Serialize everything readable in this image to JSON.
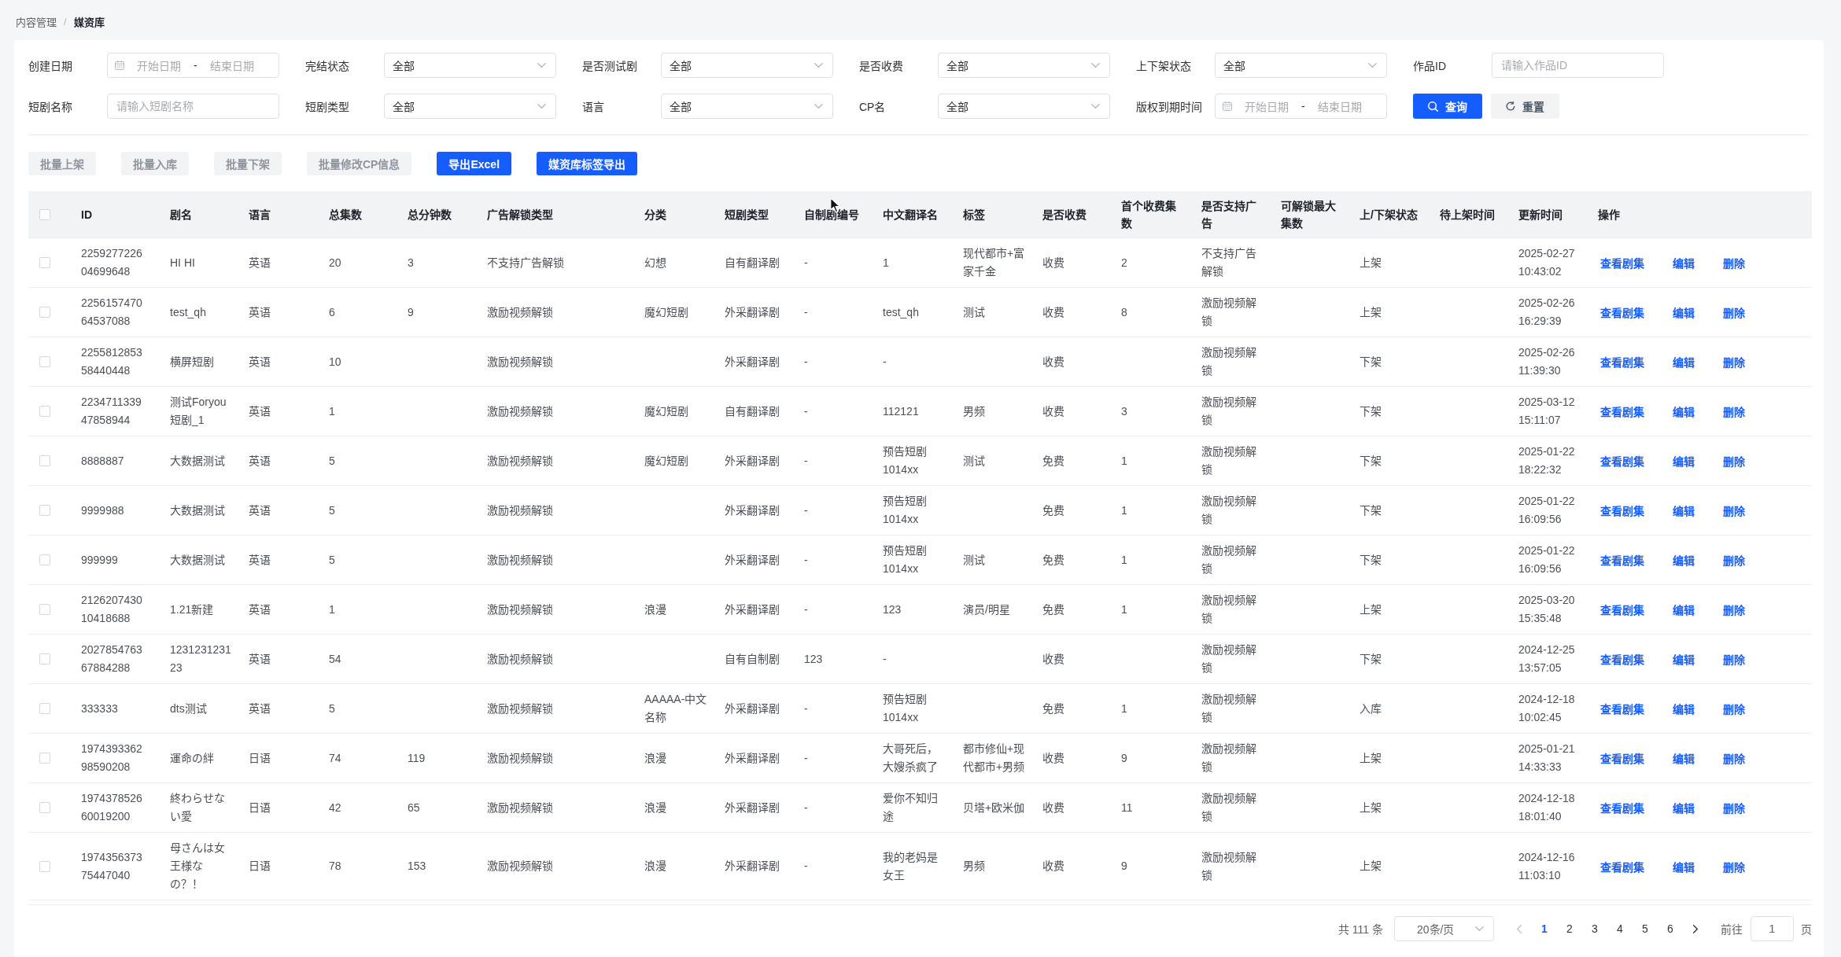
{
  "breadcrumb": {
    "separator": "/",
    "items": [
      {
        "label": "内容管理",
        "current": false
      },
      {
        "label": "媒资库",
        "current": true
      }
    ]
  },
  "filters": [
    {
      "kind": "date_range",
      "label": "创建日期",
      "start_placeholder": "开始日期",
      "separator": "-",
      "end_placeholder": "结束日期"
    },
    {
      "kind": "select",
      "label": "完结状态",
      "value": "全部"
    },
    {
      "kind": "select",
      "label": "是否测试剧",
      "value": "全部"
    },
    {
      "kind": "select",
      "label": "是否收费",
      "value": "全部"
    },
    {
      "kind": "select",
      "label": "上下架状态",
      "value": "全部"
    },
    {
      "kind": "input",
      "label": "作品ID",
      "placeholder": "请输入作品ID"
    },
    {
      "kind": "input",
      "label": "短剧名称",
      "placeholder": "请输入短剧名称"
    },
    {
      "kind": "select",
      "label": "短剧类型",
      "value": "全部"
    },
    {
      "kind": "select",
      "label": "语言",
      "value": "全部"
    },
    {
      "kind": "select",
      "label": "CP名",
      "value": "全部"
    },
    {
      "kind": "date_range",
      "label": "版权到期时间",
      "start_placeholder": "开始日期",
      "separator": "-",
      "end_placeholder": "结束日期"
    }
  ],
  "filter_actions": [
    {
      "kind": "search",
      "label": "查询"
    },
    {
      "kind": "reset",
      "label": "重置"
    }
  ],
  "toolbar": [
    {
      "label": "批量上架",
      "kind": "default",
      "disabled": true
    },
    {
      "label": "批量入库",
      "kind": "default",
      "disabled": true
    },
    {
      "label": "批量下架",
      "kind": "default",
      "disabled": true
    },
    {
      "label": "批量修改CP信息",
      "kind": "default",
      "disabled": true
    },
    {
      "label": "导出Excel",
      "kind": "primary",
      "disabled": false
    },
    {
      "label": "媒资库标签导出",
      "kind": "primary",
      "disabled": false
    }
  ],
  "table": {
    "select_all_checked": false,
    "columns": [
      "ID",
      "剧名",
      "语言",
      "总集数",
      "总分钟数",
      "广告解锁类型",
      "分类",
      "短剧类型",
      "自制剧编号",
      "中文翻译名",
      "标签",
      "是否收费",
      "首个收费集数",
      "是否支持广告",
      "可解锁最大集数",
      "上/下架状态",
      "待上架时间",
      "更新时间",
      "操作"
    ],
    "rows": [
      {
        "checked": false,
        "cells": [
          "225927722604699648",
          "HI HI",
          "英语",
          "20",
          "3",
          "不支持广告解锁",
          "幻想",
          "自有翻译剧",
          "-",
          "1",
          "现代都市+富家千金",
          "收费",
          "2",
          "不支持广告解锁",
          null,
          "上架",
          null,
          "2025-02-27 10:43:02"
        ],
        "actions": [
          "查看剧集",
          "编辑",
          "删除"
        ]
      },
      {
        "checked": false,
        "cells": [
          "225615747064537088",
          "test_qh",
          "英语",
          "6",
          "9",
          "激励视频解锁",
          "魔幻短剧",
          "外采翻译剧",
          "-",
          "test_qh",
          "测试",
          "收费",
          "8",
          "激励视频解锁",
          null,
          "上架",
          null,
          "2025-02-26 16:29:39"
        ],
        "actions": [
          "查看剧集",
          "编辑",
          "删除"
        ]
      },
      {
        "checked": false,
        "cells": [
          "225581285358440448",
          "横屏短剧",
          "英语",
          "10",
          null,
          "激励视频解锁",
          null,
          "外采翻译剧",
          "-",
          "-",
          null,
          "收费",
          null,
          "激励视频解锁",
          null,
          "下架",
          null,
          "2025-02-26 11:39:30"
        ],
        "actions": [
          "查看剧集",
          "编辑",
          "删除"
        ]
      },
      {
        "checked": false,
        "cells": [
          "223471133947858944",
          "测试Foryou短剧_1",
          "英语",
          "1",
          null,
          "激励视频解锁",
          "魔幻短剧",
          "自有翻译剧",
          "-",
          "112121",
          "男频",
          "收费",
          "3",
          "激励视频解锁",
          null,
          "下架",
          null,
          "2025-03-12 15:11:07"
        ],
        "actions": [
          "查看剧集",
          "编辑",
          "删除"
        ]
      },
      {
        "checked": false,
        "cells": [
          "8888887",
          "大数据测试",
          "英语",
          "5",
          null,
          "激励视频解锁",
          "魔幻短剧",
          "外采翻译剧",
          "-",
          "预告短剧1014xx",
          "测试",
          "免费",
          "1",
          "激励视频解锁",
          null,
          "下架",
          null,
          "2025-01-22 18:22:32"
        ],
        "actions": [
          "查看剧集",
          "编辑",
          "删除"
        ]
      },
      {
        "checked": false,
        "cells": [
          "9999988",
          "大数据测试",
          "英语",
          "5",
          null,
          "激励视频解锁",
          null,
          "外采翻译剧",
          "-",
          "预告短剧1014xx",
          null,
          "免费",
          "1",
          "激励视频解锁",
          null,
          "下架",
          null,
          "2025-01-22 16:09:56"
        ],
        "actions": [
          "查看剧集",
          "编辑",
          "删除"
        ]
      },
      {
        "checked": false,
        "cells": [
          "999999",
          "大数据测试",
          "英语",
          "5",
          null,
          "激励视频解锁",
          null,
          "外采翻译剧",
          "-",
          "预告短剧1014xx",
          "测试",
          "免费",
          "1",
          "激励视频解锁",
          null,
          "下架",
          null,
          "2025-01-22 16:09:56"
        ],
        "actions": [
          "查看剧集",
          "编辑",
          "删除"
        ]
      },
      {
        "checked": false,
        "cells": [
          "212620743010418688",
          "1.21新建",
          "英语",
          "1",
          null,
          "激励视频解锁",
          "浪漫",
          "外采翻译剧",
          "-",
          "123",
          "演员/明星",
          "免费",
          "1",
          "激励视频解锁",
          null,
          "上架",
          null,
          "2025-03-20 15:35:48"
        ],
        "actions": [
          "查看剧集",
          "编辑",
          "删除"
        ]
      },
      {
        "checked": false,
        "cells": [
          "202785476367884288",
          "123123123123",
          "英语",
          "54",
          null,
          "激励视频解锁",
          null,
          "自有自制剧",
          "123",
          "-",
          null,
          "收费",
          null,
          "激励视频解锁",
          null,
          "下架",
          null,
          "2024-12-25 13:57:05"
        ],
        "actions": [
          "查看剧集",
          "编辑",
          "删除"
        ]
      },
      {
        "checked": false,
        "cells": [
          "333333",
          "dts测试",
          "英语",
          "5",
          null,
          "激励视频解锁",
          "AAAAA-中文名称",
          "外采翻译剧",
          "-",
          "预告短剧1014xx",
          null,
          "免费",
          "1",
          "激励视频解锁",
          null,
          "入库",
          null,
          "2024-12-18 10:02:45"
        ],
        "actions": [
          "查看剧集",
          "编辑",
          "删除"
        ]
      },
      {
        "checked": false,
        "cells": [
          "197439336298590208",
          "運命の絆",
          "日语",
          "74",
          "119",
          "激励视频解锁",
          "浪漫",
          "外采翻译剧",
          "-",
          "大哥死后，大嫂杀疯了",
          "都市修仙+现代都市+男频",
          "收费",
          "9",
          "激励视频解锁",
          null,
          "上架",
          null,
          "2025-01-21 14:33:33"
        ],
        "actions": [
          "查看剧集",
          "编辑",
          "删除"
        ]
      },
      {
        "checked": false,
        "cells": [
          "197437852660019200",
          "終わらせない愛",
          "日语",
          "42",
          "65",
          "激励视频解锁",
          "浪漫",
          "外采翻译剧",
          "-",
          "爱你不知归途",
          "贝塔+欧米伽",
          "收费",
          "11",
          "激励视频解锁",
          null,
          "上架",
          null,
          "2024-12-18 18:01:40"
        ],
        "actions": [
          "查看剧集",
          "编辑",
          "删除"
        ]
      },
      {
        "checked": false,
        "cells": [
          "197435637375447040",
          "母さんは女王様なの？！",
          "日语",
          "78",
          "153",
          "激励视频解锁",
          "浪漫",
          "外采翻译剧",
          "-",
          "我的老妈是女王",
          "男频",
          "收费",
          "9",
          "激励视频解锁",
          null,
          "上架",
          null,
          "2024-12-16 11:03:10"
        ],
        "actions": [
          "查看剧集",
          "编辑",
          "删除"
        ]
      }
    ]
  },
  "pagination": {
    "total": "共 111 条",
    "page_size": "20条/页",
    "prev_disabled": true,
    "pages": [
      {
        "label": "1",
        "selected": true
      },
      {
        "label": "2",
        "selected": false
      },
      {
        "label": "3",
        "selected": false
      },
      {
        "label": "4",
        "selected": false
      },
      {
        "label": "5",
        "selected": false
      },
      {
        "label": "6",
        "selected": false
      }
    ],
    "next_disabled": false,
    "jump_label": "前往",
    "jump_value": "1",
    "jump_suffix": "页"
  }
}
